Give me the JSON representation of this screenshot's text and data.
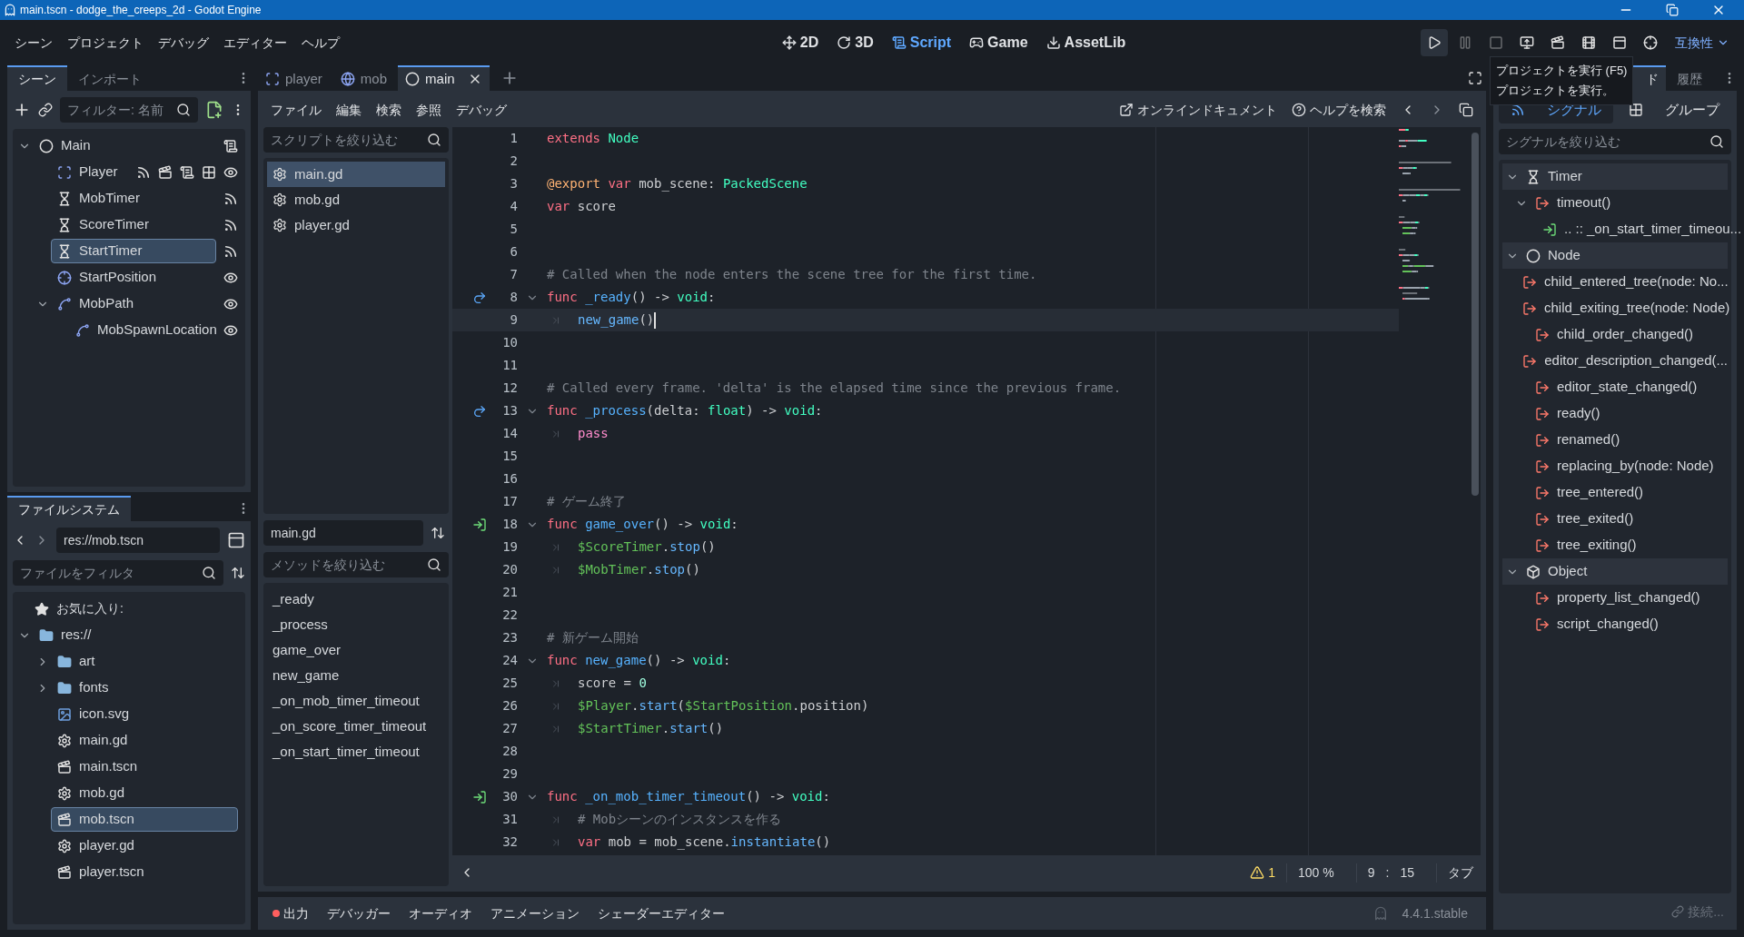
{
  "window": {
    "title": "main.tscn - dodge_the_creeps_2d - Godot Engine"
  },
  "menu": [
    "シーン",
    "プロジェクト",
    "デバッグ",
    "エディター",
    "ヘルプ"
  ],
  "workspaces": [
    {
      "label": "2D",
      "kind": "flat",
      "selected": false
    },
    {
      "label": "3D",
      "kind": "spatial",
      "selected": false
    },
    {
      "label": "Script",
      "kind": "script",
      "selected": true
    },
    {
      "label": "Game",
      "kind": "game",
      "selected": false
    },
    {
      "label": "AssetLib",
      "kind": "assetlib",
      "selected": false
    }
  ],
  "run_buttons": [
    {
      "kind": "play",
      "disabled": false
    },
    {
      "kind": "pause",
      "disabled": true
    },
    {
      "kind": "stop",
      "disabled": true
    },
    {
      "kind": "remote",
      "disabled": false
    },
    {
      "kind": "movie",
      "disabled": false
    },
    {
      "kind": "scene",
      "disabled": false
    },
    {
      "kind": "custom",
      "disabled": false
    },
    {
      "kind": "search",
      "disabled": false
    }
  ],
  "renderer": "互換性",
  "tooltip": {
    "title": "プロジェクトを実行 (F5)",
    "text": "プロジェクトを実行。"
  },
  "scene_dock": {
    "tabs": [
      {
        "label": "シーン",
        "selected": true
      },
      {
        "label": "インポート",
        "selected": false
      }
    ],
    "filter": {
      "placeholder": "フィルター: 名前"
    },
    "tree": [
      {
        "label": "Main",
        "kind": "node",
        "expanded": true,
        "selected": false,
        "badges": [
          {
            "kind": "script"
          }
        ],
        "children": [
          {
            "label": "Player",
            "kind": "area",
            "selected": false,
            "badges": [
              {
                "kind": "signal"
              },
              {
                "kind": "scene"
              },
              {
                "kind": "script"
              },
              {
                "kind": "group"
              },
              {
                "kind": "visible"
              }
            ]
          },
          {
            "label": "MobTimer",
            "kind": "timer",
            "selected": false,
            "badges": [
              {
                "kind": "signal"
              }
            ]
          },
          {
            "label": "ScoreTimer",
            "kind": "timer",
            "selected": false,
            "badges": [
              {
                "kind": "signal"
              }
            ]
          },
          {
            "label": "StartTimer",
            "kind": "timer",
            "selected": true,
            "badges": [
              {
                "kind": "signal"
              }
            ]
          },
          {
            "label": "StartPosition",
            "kind": "marker",
            "selected": false,
            "badges": [
              {
                "kind": "visible"
              }
            ]
          },
          {
            "label": "MobPath",
            "kind": "path",
            "expanded": true,
            "selected": false,
            "badges": [
              {
                "kind": "visible"
              }
            ],
            "children": [
              {
                "label": "MobSpawnLocation",
                "kind": "path",
                "selected": false,
                "badges": [
                  {
                    "kind": "visible"
                  }
                ]
              }
            ]
          }
        ]
      }
    ]
  },
  "filesystem": {
    "tab": "ファイルシステム",
    "path": "res://mob.tscn",
    "filter": {
      "placeholder": "ファイルをフィルタ"
    },
    "favorites": "お気に入り:",
    "tree": [
      {
        "label": "res://",
        "kind": "folder",
        "expanded": true,
        "selected": false,
        "children": [
          {
            "label": "art",
            "kind": "folder",
            "expanded": false,
            "selected": false
          },
          {
            "label": "fonts",
            "kind": "folder",
            "expanded": false,
            "selected": false
          },
          {
            "label": "icon.svg",
            "kind": "image",
            "selected": false
          },
          {
            "label": "main.gd",
            "kind": "script",
            "selected": false
          },
          {
            "label": "main.tscn",
            "kind": "scene",
            "selected": false
          },
          {
            "label": "mob.gd",
            "kind": "script",
            "selected": false
          },
          {
            "label": "mob.tscn",
            "kind": "scene",
            "selected": true
          },
          {
            "label": "player.gd",
            "kind": "script",
            "selected": false
          },
          {
            "label": "player.tscn",
            "kind": "scene",
            "selected": false
          }
        ]
      }
    ]
  },
  "editor_tabs": [
    {
      "label": "player",
      "kind": "area",
      "selected": false
    },
    {
      "label": "mob",
      "kind": "rigid",
      "selected": false
    },
    {
      "label": "main",
      "kind": "node",
      "selected": true
    }
  ],
  "script_menu": [
    "ファイル",
    "編集",
    "検索",
    "参照",
    "デバッグ"
  ],
  "online_docs": "オンラインドキュメント",
  "search_help": "ヘルプを検索",
  "script_filter": {
    "placeholder": "スクリプトを絞り込む"
  },
  "scripts": [
    {
      "label": "main.gd",
      "selected": true
    },
    {
      "label": "mob.gd",
      "selected": false
    },
    {
      "label": "player.gd",
      "selected": false
    }
  ],
  "current_script": "main.gd",
  "method_filter": {
    "placeholder": "メソッドを絞り込む"
  },
  "methods": [
    "_ready",
    "_process",
    "game_over",
    "new_game",
    "_on_mob_timer_timeout",
    "_on_score_timer_timeout",
    "_on_start_timer_timeout"
  ],
  "code": [
    {
      "number": "1",
      "tokens": [
        {
          "kind": "keyword",
          "text": "extends "
        },
        {
          "kind": "type",
          "text": "Node"
        }
      ]
    },
    {
      "number": "2"
    },
    {
      "number": "3",
      "tokens": [
        {
          "kind": "annotation",
          "text": "@export "
        },
        {
          "kind": "keyword",
          "text": "var"
        },
        {
          "kind": "plain",
          "text": " mob_scene: "
        },
        {
          "kind": "type",
          "text": "PackedScene"
        }
      ]
    },
    {
      "number": "4",
      "tokens": [
        {
          "kind": "keyword",
          "text": "var"
        },
        {
          "kind": "plain",
          "text": " score"
        }
      ]
    },
    {
      "number": "5"
    },
    {
      "number": "6"
    },
    {
      "number": "7",
      "tokens": [
        {
          "kind": "comment",
          "text": "# Called when the node enters the scene tree for the first time."
        }
      ]
    },
    {
      "number": "8",
      "overridden": true,
      "foldable": true,
      "tokens": [
        {
          "kind": "keyword",
          "text": "func "
        },
        {
          "kind": "func",
          "text": "_ready"
        },
        {
          "kind": "plain",
          "text": "() -> "
        },
        {
          "kind": "type",
          "text": "void"
        },
        {
          "kind": "plain",
          "text": ":"
        }
      ]
    },
    {
      "number": "9",
      "indented": true,
      "current": true,
      "tokens": [
        {
          "kind": "call",
          "text": "new_game"
        },
        {
          "kind": "plain",
          "text": "()"
        }
      ]
    },
    {
      "number": "10"
    },
    {
      "number": "11"
    },
    {
      "number": "12",
      "tokens": [
        {
          "kind": "comment",
          "text": "# Called every frame. 'delta' is the elapsed time since the previous frame."
        }
      ]
    },
    {
      "number": "13",
      "overridden": true,
      "foldable": true,
      "tokens": [
        {
          "kind": "keyword",
          "text": "func "
        },
        {
          "kind": "func",
          "text": "_process"
        },
        {
          "kind": "plain",
          "text": "(delta: "
        },
        {
          "kind": "type",
          "text": "float"
        },
        {
          "kind": "plain",
          "text": ") -> "
        },
        {
          "kind": "type",
          "text": "void"
        },
        {
          "kind": "plain",
          "text": ":"
        }
      ]
    },
    {
      "number": "14",
      "indented": true,
      "tokens": [
        {
          "kind": "flow",
          "text": "pass"
        }
      ]
    },
    {
      "number": "15"
    },
    {
      "number": "16"
    },
    {
      "number": "17",
      "tokens": [
        {
          "kind": "comment",
          "text": "# ゲーム終了"
        }
      ]
    },
    {
      "number": "18",
      "connected": true,
      "foldable": true,
      "tokens": [
        {
          "kind": "keyword",
          "text": "func "
        },
        {
          "kind": "func",
          "text": "game_over"
        },
        {
          "kind": "plain",
          "text": "() -> "
        },
        {
          "kind": "type",
          "text": "void"
        },
        {
          "kind": "plain",
          "text": ":"
        }
      ]
    },
    {
      "number": "19",
      "indented": true,
      "tokens": [
        {
          "kind": "node",
          "text": "$ScoreTimer"
        },
        {
          "kind": "plain",
          "text": "."
        },
        {
          "kind": "call",
          "text": "stop"
        },
        {
          "kind": "plain",
          "text": "()"
        }
      ]
    },
    {
      "number": "20",
      "indented": true,
      "tokens": [
        {
          "kind": "node",
          "text": "$MobTimer"
        },
        {
          "kind": "plain",
          "text": "."
        },
        {
          "kind": "call",
          "text": "stop"
        },
        {
          "kind": "plain",
          "text": "()"
        }
      ]
    },
    {
      "number": "21"
    },
    {
      "number": "22"
    },
    {
      "number": "23",
      "tokens": [
        {
          "kind": "comment",
          "text": "# 新ゲーム開始"
        }
      ]
    },
    {
      "number": "24",
      "foldable": true,
      "tokens": [
        {
          "kind": "keyword",
          "text": "func "
        },
        {
          "kind": "func",
          "text": "new_game"
        },
        {
          "kind": "plain",
          "text": "() -> "
        },
        {
          "kind": "type",
          "text": "void"
        },
        {
          "kind": "plain",
          "text": ":"
        }
      ]
    },
    {
      "number": "25",
      "indented": true,
      "tokens": [
        {
          "kind": "plain",
          "text": "score = "
        },
        {
          "kind": "number",
          "text": "0"
        }
      ]
    },
    {
      "number": "26",
      "indented": true,
      "tokens": [
        {
          "kind": "node",
          "text": "$Player"
        },
        {
          "kind": "plain",
          "text": "."
        },
        {
          "kind": "call",
          "text": "start"
        },
        {
          "kind": "plain",
          "text": "("
        },
        {
          "kind": "node",
          "text": "$StartPosition"
        },
        {
          "kind": "plain",
          "text": ".position)"
        }
      ]
    },
    {
      "number": "27",
      "indented": true,
      "tokens": [
        {
          "kind": "node",
          "text": "$StartTimer"
        },
        {
          "kind": "plain",
          "text": "."
        },
        {
          "kind": "call",
          "text": "start"
        },
        {
          "kind": "plain",
          "text": "()"
        }
      ]
    },
    {
      "number": "28"
    },
    {
      "number": "29"
    },
    {
      "number": "30",
      "connected": true,
      "foldable": true,
      "tokens": [
        {
          "kind": "keyword",
          "text": "func "
        },
        {
          "kind": "func",
          "text": "_on_mob_timer_timeout"
        },
        {
          "kind": "plain",
          "text": "() -> "
        },
        {
          "kind": "type",
          "text": "void"
        },
        {
          "kind": "plain",
          "text": ":"
        }
      ]
    },
    {
      "number": "31",
      "indented": true,
      "tokens": [
        {
          "kind": "comment",
          "text": "# Mobシーンのインスタンスを作る"
        }
      ]
    },
    {
      "number": "32",
      "indented": true,
      "tokens": [
        {
          "kind": "keyword",
          "text": "var"
        },
        {
          "kind": "plain",
          "text": " mob = mob_scene."
        },
        {
          "kind": "call",
          "text": "instantiate"
        },
        {
          "kind": "plain",
          "text": "()"
        }
      ]
    }
  ],
  "status_bar": {
    "warnings": "1",
    "zoom": "100 %",
    "line": "9",
    "separator": ":",
    "column": "15",
    "indent": "タブ"
  },
  "bottom_tabs": [
    {
      "label": "出力",
      "alert": true
    },
    {
      "label": "デバッガー",
      "alert": false
    },
    {
      "label": "オーディオ",
      "alert": false
    },
    {
      "label": "アニメーション",
      "alert": false
    },
    {
      "label": "シェーダーエディター",
      "alert": false
    }
  ],
  "version": "4.4.1.stable",
  "node_dock": {
    "tabs": [
      {
        "label": "ド",
        "selected": true
      },
      {
        "label": "履歴",
        "selected": false
      }
    ],
    "subtabs": [
      {
        "label": "シグナル",
        "kind": "signals",
        "selected": true
      },
      {
        "label": "グループ",
        "kind": "groups",
        "selected": false
      }
    ],
    "filter": {
      "placeholder": "シグナルを絞り込む"
    },
    "classes": [
      {
        "name": "Timer",
        "kind": "timer",
        "expanded": true,
        "signals": [
          {
            "label": "timeout()",
            "expanded": true,
            "connections": [
              ".. :: _on_start_timer_timeou..."
            ]
          }
        ]
      },
      {
        "name": "Node",
        "kind": "node",
        "expanded": true,
        "signals": [
          {
            "label": "child_entered_tree(node: No..."
          },
          {
            "label": "child_exiting_tree(node: Node)"
          },
          {
            "label": "child_order_changed()"
          },
          {
            "label": "editor_description_changed(..."
          },
          {
            "label": "editor_state_changed()"
          },
          {
            "label": "ready()"
          },
          {
            "label": "renamed()"
          },
          {
            "label": "replacing_by(node: Node)"
          },
          {
            "label": "tree_entered()"
          },
          {
            "label": "tree_exited()"
          },
          {
            "label": "tree_exiting()"
          }
        ]
      },
      {
        "name": "Object",
        "kind": "object",
        "expanded": true,
        "signals": [
          {
            "label": "property_list_changed()"
          },
          {
            "label": "script_changed()"
          }
        ]
      }
    ],
    "connect": {
      "label": "接続...",
      "disabled": true
    }
  }
}
